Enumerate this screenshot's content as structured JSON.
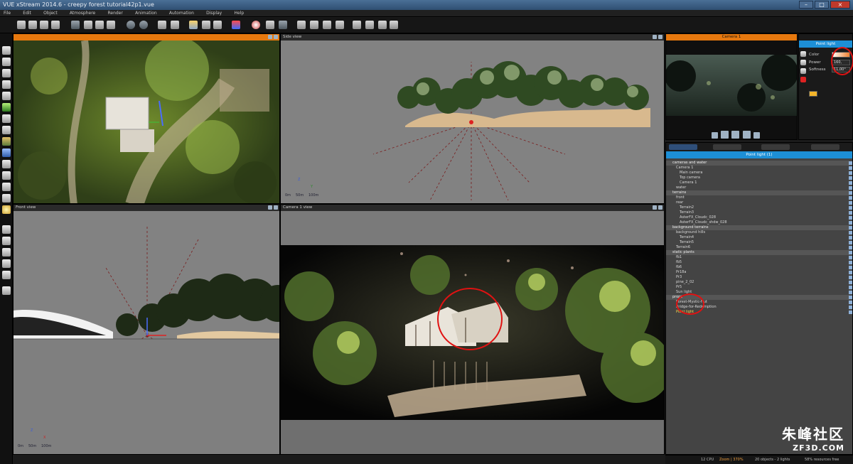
{
  "window": {
    "title": "VUE xStream 2014.6 - creepy forest tutorial42p1.vue"
  },
  "menu": [
    "File",
    "Edit",
    "Object",
    "Atmosphere",
    "Render",
    "Animation",
    "Automation",
    "Display",
    "Help"
  ],
  "viewports": {
    "top": {
      "label": ""
    },
    "side": {
      "label": "Side view"
    },
    "front": {
      "label": "Front view"
    },
    "camera": {
      "label": "Camera 1 view"
    }
  },
  "axes": {
    "z": "Z",
    "y": "Y",
    "x": "X",
    "scale": [
      "0m",
      "50m",
      "100m"
    ],
    "scale_front": [
      "0m",
      "50m",
      "100m"
    ]
  },
  "camera_window": {
    "title": "Camera 1"
  },
  "properties": {
    "header": "Point light",
    "color_label": "Color",
    "power_label": "Power",
    "power_value": "160,",
    "softness_label": "Softness",
    "softness_value": "11,00°"
  },
  "world_browser": {
    "header": "Point light (1)",
    "rows": [
      {
        "text": "cameras and water",
        "group": true
      },
      {
        "text": "Camera 1",
        "indent": 2
      },
      {
        "text": "Main camera",
        "indent": 3
      },
      {
        "text": "Top camera",
        "indent": 3
      },
      {
        "text": "Camera 1",
        "indent": 3
      },
      {
        "text": "water",
        "indent": 2
      },
      {
        "text": "terrains",
        "group": true
      },
      {
        "text": "front",
        "indent": 2
      },
      {
        "text": "rear",
        "indent": 2
      },
      {
        "text": "Terrain2",
        "indent": 3
      },
      {
        "text": "Terrain3",
        "indent": 3
      },
      {
        "text": "AsterFX_Cloudc_028",
        "indent": 3
      },
      {
        "text": "AsterFX_Cloudc_shdw_028",
        "indent": 3
      },
      {
        "text": "background terrains",
        "group": true
      },
      {
        "text": "background hills",
        "indent": 2
      },
      {
        "text": "Terrain4",
        "indent": 3
      },
      {
        "text": "Terrain5",
        "indent": 3
      },
      {
        "text": "Terrain6",
        "indent": 2
      },
      {
        "text": "static plants",
        "group": true
      },
      {
        "text": "fb1",
        "indent": 2
      },
      {
        "text": "fb5",
        "indent": 2
      },
      {
        "text": "fb6",
        "indent": 2
      },
      {
        "text": "Pr18a",
        "indent": 2
      },
      {
        "text": "Pr3",
        "indent": 2
      },
      {
        "text": "pine_2_02",
        "indent": 2
      },
      {
        "text": "Pr5",
        "indent": 2
      },
      {
        "text": "Sun light",
        "indent": 2
      },
      {
        "text": "props",
        "group": true
      },
      {
        "text": "Forest-Mystic-Hut",
        "indent": 2
      },
      {
        "text": "Bridge-for-Redemption",
        "indent": 2
      },
      {
        "text": "Point light",
        "indent": 2,
        "selected": true
      }
    ]
  },
  "status": {
    "cpu": "12 CPU",
    "zoom": "Zoom | 370%",
    "objects": "20 objects - 2 lights",
    "resources": "58% resources free"
  },
  "watermark": {
    "zh": "朱峰社区",
    "en": "ZF3D.COM"
  },
  "colors": {
    "accent": "#e6780e",
    "selection": "#1d8fd6",
    "annotation": "#e01212"
  }
}
